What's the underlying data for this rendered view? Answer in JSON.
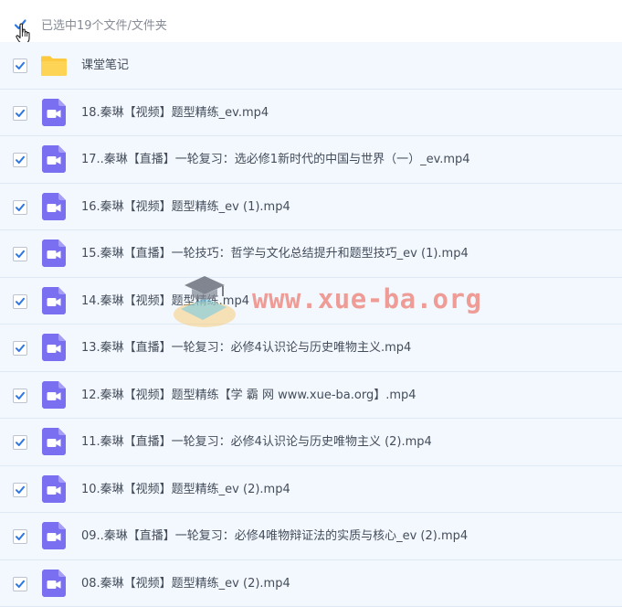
{
  "header": {
    "selection_text": "已选中19个文件/文件夹"
  },
  "files": [
    {
      "name": "课堂笔记",
      "type": "folder"
    },
    {
      "name": "18.秦琳【视频】题型精练_ev.mp4",
      "type": "video"
    },
    {
      "name": "17..秦琳【直播】一轮复习：选必修1新时代的中国与世界（一）_ev.mp4",
      "type": "video"
    },
    {
      "name": "16.秦琳【视频】题型精练_ev (1).mp4",
      "type": "video"
    },
    {
      "name": "15.秦琳【直播】一轮技巧：哲学与文化总结提升和题型技巧_ev (1).mp4",
      "type": "video"
    },
    {
      "name": "14.秦琳【视频】题型精练.mp4",
      "type": "video"
    },
    {
      "name": "13.秦琳【直播】一轮复习：必修4认识论与历史唯物主义.mp4",
      "type": "video"
    },
    {
      "name": "12.秦琳【视频】题型精练【学 霸 网 www.xue-ba.org】.mp4",
      "type": "video"
    },
    {
      "name": "11.秦琳【直播】一轮复习：必修4认识论与历史唯物主义 (2).mp4",
      "type": "video"
    },
    {
      "name": "10.秦琳【视频】题型精练_ev (2).mp4",
      "type": "video"
    },
    {
      "name": "09..秦琳【直播】一轮复习：必修4唯物辩证法的实质与核心_ev (2).mp4",
      "type": "video"
    },
    {
      "name": "08.秦琳【视频】题型精练_ev (2).mp4",
      "type": "video"
    }
  ],
  "watermark": {
    "text": "www.xue-ba.org"
  },
  "colors": {
    "checkbox_check": "#2f78e3",
    "folder": "#fcc93f",
    "video_icon": "#7a6ff0",
    "row_bg": "#f2f8fe",
    "watermark": "#ed796e"
  }
}
